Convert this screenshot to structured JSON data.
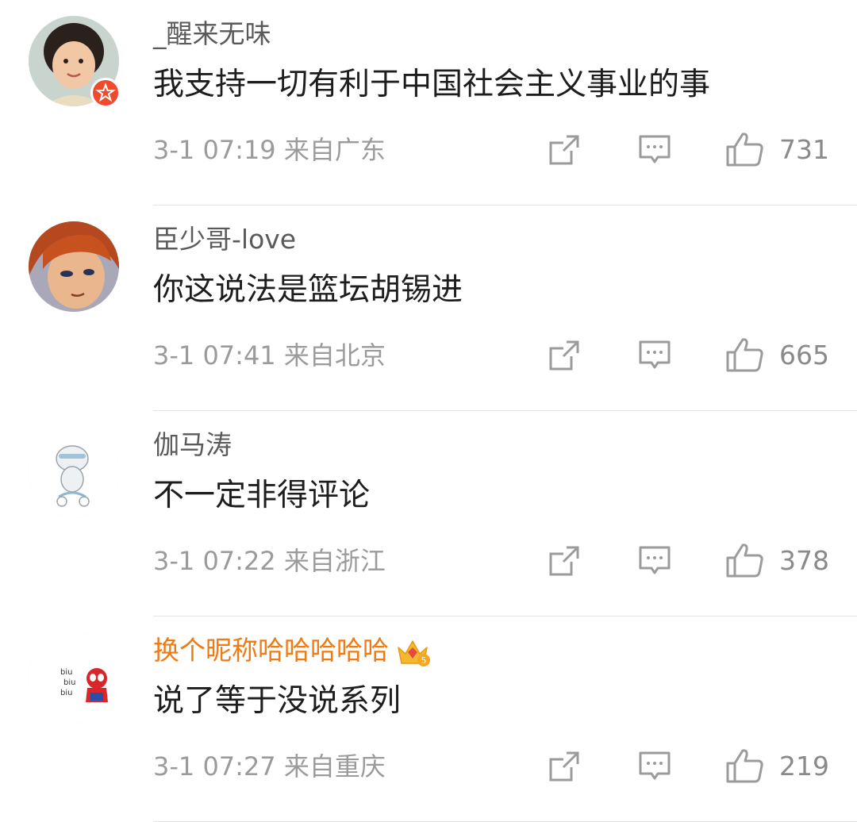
{
  "comments": [
    {
      "username": "_醒来无味",
      "text": "我支持一切有利于中国社会主义事业的事",
      "time": "3-1 07:19",
      "location": "来自广东",
      "likes": "731",
      "vip": false,
      "verified": true
    },
    {
      "username": "臣少哥-love",
      "text": "你这说法是篮坛胡锡进",
      "time": "3-1 07:41",
      "location": "来自北京",
      "likes": "665",
      "vip": false,
      "verified": false
    },
    {
      "username": "伽马涛",
      "text": "不一定非得评论",
      "time": "3-1 07:22",
      "location": "来自浙江",
      "likes": "378",
      "vip": false,
      "verified": false
    },
    {
      "username": "换个昵称哈哈哈哈哈",
      "text": "说了等于没说系列",
      "time": "3-1 07:27",
      "location": "来自重庆",
      "likes": "219",
      "vip": true,
      "vip_level": "5",
      "verified": false
    }
  ],
  "icons": {
    "share": "share-icon",
    "reply": "comment-icon",
    "like": "thumbs-up-icon"
  },
  "colors": {
    "vip_name": "#f07a14",
    "verified_badge": "#f04a2c",
    "meta_text": "#9b9b9b"
  }
}
